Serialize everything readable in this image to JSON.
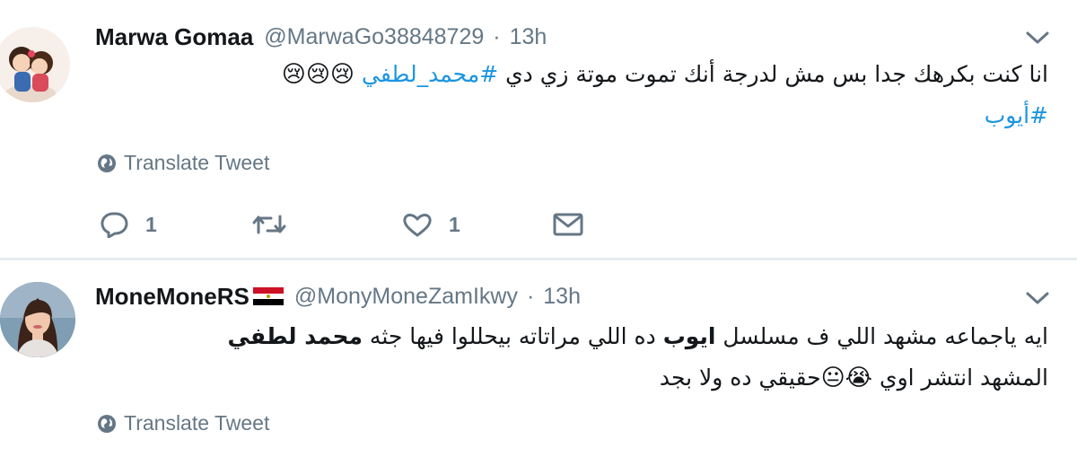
{
  "tweets": [
    {
      "name": "Marwa Gomaa",
      "handle": "@MarwaGo38848729",
      "separator": "·",
      "time": "13h",
      "text_part1": "انا كنت بكرهك جدا بس مش لدرجة أنك تموت موتة زي دي ",
      "hashtag1": "#محمد_لطفي",
      "emojis": "😢😢😢",
      "hashtag2": "#أيوب",
      "translate_label": "Translate Tweet",
      "reply_count": "1",
      "like_count": "1"
    },
    {
      "name": "MoneMoneRS",
      "handle": "@MonyMoneZamIkwy",
      "separator": "·",
      "time": "13h",
      "text_part1": "ايه ياجماعه مشهد اللي ف مسلسل ",
      "bold1": "ايوب",
      "text_part2": " ده اللي مراتاته بيحللوا فيها جثه ",
      "bold2": "محمد لطفي",
      "text_line2": "المشهد انتشر اوي ",
      "emojis": "😭😐",
      "text_line2_end": "حقيقي ده ولا بجد",
      "translate_label": "Translate Tweet"
    }
  ],
  "colors": {
    "link": "#1b95e0",
    "secondary_text": "#657786",
    "divider": "#e6ecf0"
  },
  "icons": [
    "globe-icon",
    "reply-icon",
    "retweet-icon",
    "like-icon",
    "direct-message-icon",
    "chevron-down-icon",
    "egypt-flag-icon"
  ]
}
